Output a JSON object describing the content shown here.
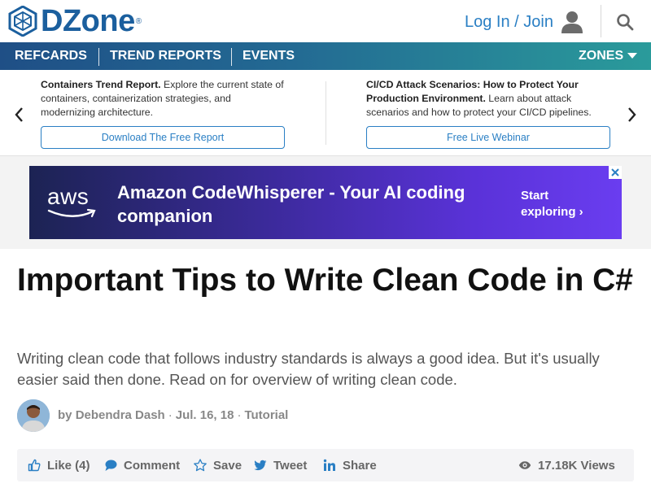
{
  "header": {
    "logo_text": "DZone",
    "logo_reg": "®",
    "login_label": "Log In / Join",
    "icons": {
      "user": "user-icon",
      "search": "search-icon"
    }
  },
  "nav": {
    "items": [
      "REFCARDS",
      "TREND REPORTS",
      "EVENTS"
    ],
    "zones_label": "ZONES"
  },
  "promos": [
    {
      "title": "Containers Trend Report.",
      "text": " Explore the current state of containers, containerization strategies, and modernizing architecture.",
      "button": "Download The Free Report"
    },
    {
      "title": "CI/CD Attack Scenarios: How to Protect Your Production Environment.",
      "text": " Learn about attack scenarios and how to protect your CI/CD pipelines.",
      "button": "Free Live Webinar"
    }
  ],
  "ad": {
    "brand": "aws",
    "headline": "Amazon CodeWhisperer - Your AI coding companion",
    "cta_line1": "Start",
    "cta_line2": "exploring ›",
    "close": "✕"
  },
  "article": {
    "title": "Important Tips to Write Clean Code in C#",
    "subtitle": "Writing clean code that follows industry standards is always a good idea. But it's usually easier said then done. Read on for overview of writing clean code.",
    "by": "by",
    "author": "Debendra Dash",
    "date": "Jul. 16, 18",
    "category": "Tutorial",
    "sep": "·"
  },
  "actions": {
    "like": "Like (4)",
    "comment": "Comment",
    "save": "Save",
    "tweet": "Tweet",
    "share": "Share",
    "views": "17.18K Views"
  },
  "colors": {
    "brand_blue": "#1b5f9e",
    "link_blue": "#2a7fc4",
    "nav_start": "#1f4f86",
    "nav_end": "#2a9b9b",
    "ad_purple": "#5a32d8"
  }
}
